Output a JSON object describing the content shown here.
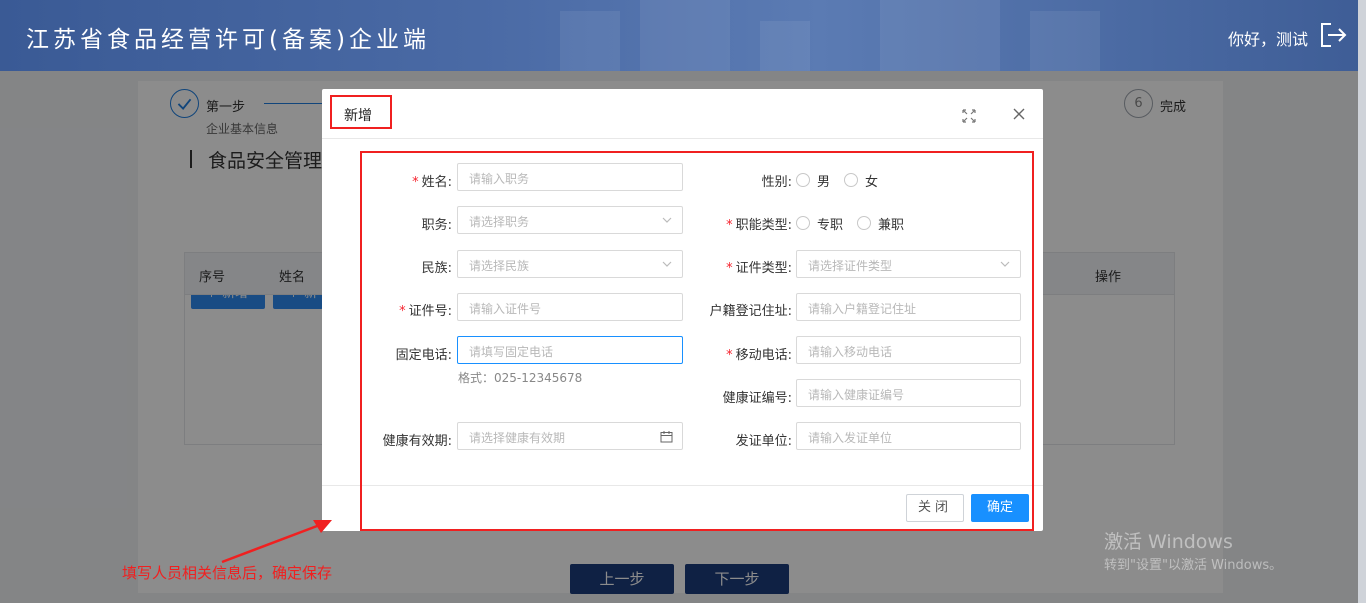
{
  "header": {
    "title": "江苏省食品经营许可(备案)企业端",
    "greeting": "你好，测试",
    "logout_icon": "logout-icon"
  },
  "steps": {
    "step1_title": "第一步",
    "step1_desc": "企业基本信息",
    "step6_num": "6",
    "step6_title": "完成"
  },
  "section": {
    "title": "食品安全管理",
    "add_btn": "新增",
    "add_btn2": "新增"
  },
  "table": {
    "col_index": "序号",
    "col_name": "姓名",
    "col_action": "操作"
  },
  "nav": {
    "prev": "上一步",
    "next": "下一步"
  },
  "modal": {
    "title": "新增",
    "close_btn": "关闭",
    "ok_btn": "确定",
    "fields": {
      "name": {
        "label": "姓名:",
        "placeholder": "请输入职务"
      },
      "gender": {
        "label": "性别:",
        "opt1": "男",
        "opt2": "女"
      },
      "position": {
        "label": "职务:",
        "placeholder": "请选择职务"
      },
      "func_type": {
        "label": "职能类型:",
        "opt1": "专职",
        "opt2": "兼职"
      },
      "ethnic": {
        "label": "民族:",
        "placeholder": "请选择民族"
      },
      "cert_type": {
        "label": "证件类型:",
        "placeholder": "请选择证件类型"
      },
      "cert_no": {
        "label": "证件号:",
        "placeholder": "请输入证件号"
      },
      "address": {
        "label": "户籍登记住址:",
        "placeholder": "请输入户籍登记住址"
      },
      "phone": {
        "label": "固定电话:",
        "placeholder": "请填写固定电话",
        "hint": "格式：025-12345678"
      },
      "mobile": {
        "label": "移动电话:",
        "placeholder": "请输入移动电话"
      },
      "health_no": {
        "label": "健康证编号:",
        "placeholder": "请输入健康证编号"
      },
      "health_date": {
        "label": "健康有效期:",
        "placeholder": "请选择健康有效期"
      },
      "issuer": {
        "label": "发证单位:",
        "placeholder": "请输入发证单位"
      }
    }
  },
  "annotation": "填写人员相关信息后，确定保存",
  "watermark": {
    "line1": "激活 Windows",
    "line2": "转到\"设置\"以激活 Windows。"
  },
  "colors": {
    "header": "#3a5a95",
    "primary": "#1890ff",
    "highlight": "#f02020",
    "nav_button": "#1d3d7c"
  }
}
